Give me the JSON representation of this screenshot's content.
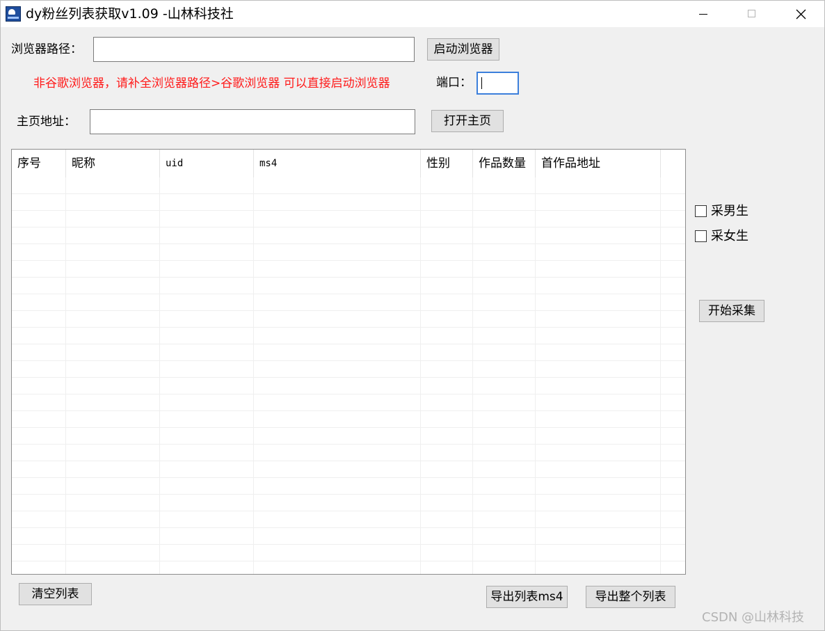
{
  "window": {
    "title": "dy粉丝列表获取v1.09 -山林科技社"
  },
  "browser_path": {
    "label": "浏览器路径：",
    "value": "",
    "launch_button": "启动浏览器"
  },
  "note": {
    "text": "非谷歌浏览器，请补全浏览器路径>谷歌浏览器 可以直接启动浏览器",
    "color": "#ff1a1a"
  },
  "port": {
    "label": "端口：",
    "value": ""
  },
  "homepage": {
    "label": "主页地址：",
    "value": "",
    "open_button": "打开主页"
  },
  "table": {
    "columns": [
      "序号",
      "昵称",
      "uid",
      "ms4",
      "性别",
      "作品数量",
      "首作品地址"
    ],
    "rows": []
  },
  "options": {
    "collect_male": {
      "label": "采男生",
      "checked": false
    },
    "collect_female": {
      "label": "采女生",
      "checked": false
    },
    "start_button": "开始采集"
  },
  "footer": {
    "clear_button": "清空列表",
    "export_ms4_button": "导出列表ms4",
    "export_all_button": "导出整个列表"
  },
  "watermark": "CSDN @山林科技"
}
